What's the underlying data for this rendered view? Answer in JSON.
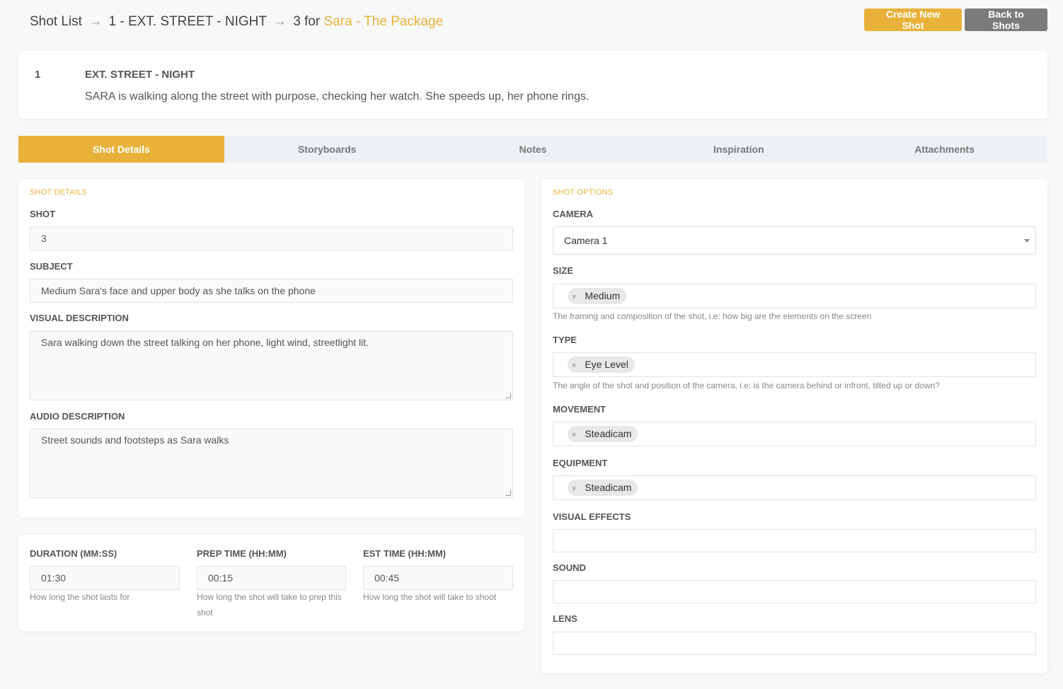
{
  "breadcrumb": {
    "root": "Shot List",
    "arrow": "→",
    "scene": "1 - EXT. STREET - NIGHT",
    "shot_for": "3 for",
    "project": "Sara - The Package"
  },
  "buttons": {
    "create": "Create New Shot",
    "back": "Back to Shots"
  },
  "scene": {
    "number": "1",
    "heading": "EXT. STREET - NIGHT",
    "description": "SARA is walking along the street with purpose, checking her watch. She speeds up, her phone rings."
  },
  "tabs": [
    "Shot Details",
    "Storyboards",
    "Notes",
    "Inspiration",
    "Attachments"
  ],
  "shot_details": {
    "section_title": "SHOT DETAILS",
    "shot_label": "SHOT",
    "shot_value": "3",
    "subject_label": "SUBJECT",
    "subject_value": "Medium Sara's face and upper body as she talks on the phone",
    "visual_label": "VISUAL DESCRIPTION",
    "visual_value": "Sara walking down the street talking on her phone, light wind, streetlight lit.",
    "audio_label": "AUDIO DESCRIPTION",
    "audio_value": "Street sounds and footsteps as Sara walks"
  },
  "times": {
    "duration_label": "DURATION (MM:SS)",
    "duration_value": "01:30",
    "duration_help": "How long the shot lasts for",
    "prep_label": "PREP TIME (HH:MM)",
    "prep_value": "00:15",
    "prep_help": "How long the shot will take to prep this shot",
    "est_label": "EST TIME (HH:MM)",
    "est_value": "00:45",
    "est_help": "How long the shot will take to shoot"
  },
  "shot_options": {
    "section_title": "SHOT OPTIONS",
    "camera_label": "CAMERA",
    "camera_value": "Camera 1",
    "size_label": "SIZE",
    "size_tag": "Medium",
    "size_help": "The framing and composition of the shot, i.e: how big are the elements on the screen",
    "type_label": "TYPE",
    "type_tag": "Eye Level",
    "type_help": "The angle of the shot and position of the camera, i.e: is the camera behind or infront, tilted up or down?",
    "movement_label": "MOVEMENT",
    "movement_tag": "Steadicam",
    "equipment_label": "EQUIPMENT",
    "equipment_tag": "Steadicam",
    "vfx_label": "VISUAL EFFECTS",
    "sound_label": "SOUND",
    "lens_label": "LENS",
    "remove_glyph": "×"
  },
  "colors": {
    "accent": "#e8b23a",
    "secondary_button": "#7b7b7b"
  }
}
